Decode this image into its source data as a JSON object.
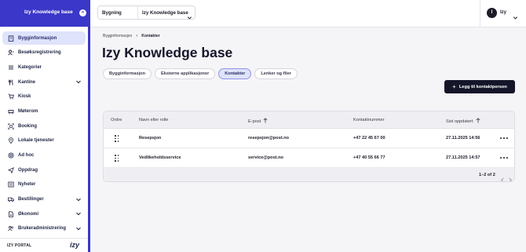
{
  "sidebar": {
    "title": "Izy Knowledge base",
    "collapse_icon": "double-chevron-left-icon",
    "items": [
      {
        "label": "Bygginformasjon",
        "icon": "building-icon",
        "active": true,
        "expandable": false
      },
      {
        "label": "Besøksregistrering",
        "icon": "visitor-icon",
        "active": false,
        "expandable": false
      },
      {
        "label": "Kategorier",
        "icon": "list-icon",
        "active": false,
        "expandable": false
      },
      {
        "label": "Kantine",
        "icon": "cutlery-icon",
        "active": false,
        "expandable": true
      },
      {
        "label": "Kiosk",
        "icon": "cart-icon",
        "active": false,
        "expandable": false
      },
      {
        "label": "Møterom",
        "icon": "meeting-room-icon",
        "active": false,
        "expandable": false
      },
      {
        "label": "Booking",
        "icon": "booking-icon",
        "active": false,
        "expandable": false
      },
      {
        "label": "Lokale tjenester",
        "icon": "location-icon",
        "active": false,
        "expandable": false
      },
      {
        "label": "Ad hoc",
        "icon": "target-icon",
        "active": false,
        "expandable": false
      },
      {
        "label": "Oppdrag",
        "icon": "send-icon",
        "active": false,
        "expandable": false
      },
      {
        "label": "Nyheter",
        "icon": "news-icon",
        "active": false,
        "expandable": false
      },
      {
        "label": "Bestillinger",
        "icon": "truck-icon",
        "active": false,
        "expandable": true
      },
      {
        "label": "Økonomi",
        "icon": "document-icon",
        "active": false,
        "expandable": true
      },
      {
        "label": "Brukeradministrering",
        "icon": "users-icon",
        "active": false,
        "expandable": true
      }
    ],
    "footer": {
      "portal_label": "IZY PORTAL",
      "logo_text": "izy"
    }
  },
  "topbar": {
    "selector_label": "Bygning",
    "selector_value": "Izy Knowledge base",
    "user_initial": "I",
    "user_name": "Izy"
  },
  "main": {
    "breadcrumb": [
      "Bygginformasjon",
      "Kontakter"
    ],
    "title": "Izy Knowledge base",
    "tabs": [
      {
        "label": "Bygginformasjon",
        "active": false
      },
      {
        "label": "Eksterne applikasjoner",
        "active": false
      },
      {
        "label": "Kontakter",
        "active": true
      },
      {
        "label": "Lenker og filer",
        "active": false
      }
    ],
    "add_button_label": "Legg til kontaktperson",
    "table": {
      "columns": [
        {
          "label": "Ordre",
          "sortable": false
        },
        {
          "label": "Navn eller rolle",
          "sortable": false
        },
        {
          "label": "E-post",
          "sortable": true
        },
        {
          "label": "Kontaktnummer",
          "sortable": false
        },
        {
          "label": "Sist oppdatert",
          "sortable": true
        }
      ],
      "rows": [
        {
          "name": "Resepsjon",
          "email": "resepsjon@post.no",
          "phone": "+47 22 45 67 00",
          "updated": "27.11.2025 14:56"
        },
        {
          "name": "Vedlikeholdsservice",
          "email": "service@post.no",
          "phone": "+47 40 55 66 77",
          "updated": "27.11.2025 14:57"
        }
      ],
      "pagination": "1–2 of 2"
    }
  }
}
